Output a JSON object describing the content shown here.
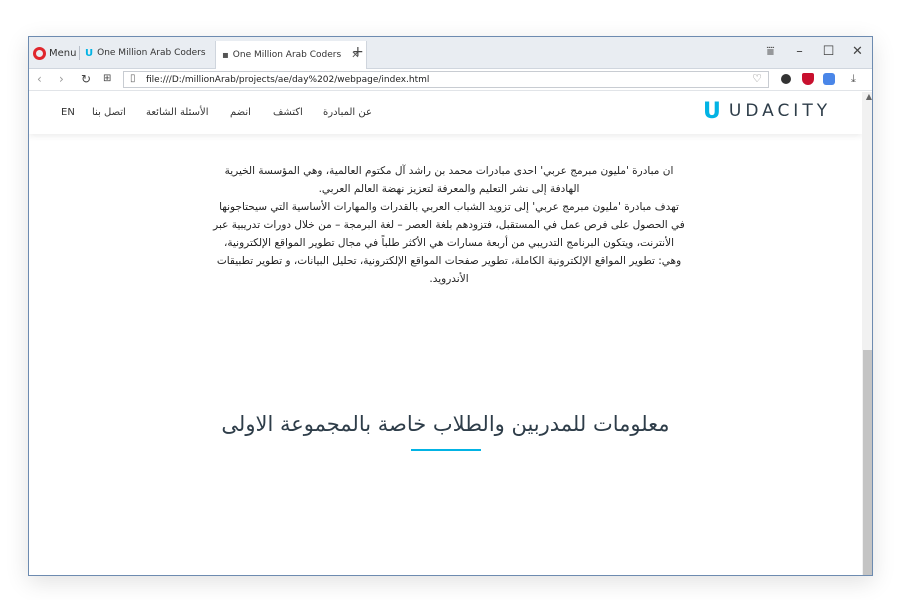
{
  "browser": {
    "menu_label": "Menu",
    "tabs": [
      {
        "title": "One Million Arab Coders",
        "active": false
      },
      {
        "title": "One Million Arab Coders",
        "active": true
      }
    ],
    "new_tab": "+",
    "url": "file:///D:/millionArab/projects/ae/day%202/webpage/index.html",
    "controls": {
      "minimize": "–",
      "maximize": "☐",
      "close": "✕",
      "tabmenu": "⩸"
    }
  },
  "site": {
    "brand": "UDACITY",
    "brand_mark": "U",
    "nav": {
      "en": "EN",
      "contact": "اتصل بنا",
      "faq": "الأسئلة الشائعة",
      "join": "انضم",
      "discover": "اكتشف",
      "about": "عن المبادرة"
    },
    "about_lines": [
      "ان مبادرة 'مليون مبرمج عربي' احدى مبادرات محمد بن راشد آل مكتوم العالمية، وهي المؤسسة الخيرية",
      "الهادفة إلى نشر التعليم والمعرفة لتعزيز نهضة العالم العربي.",
      "تهدف مبادرة 'مليون مبرمج عربي' إلى تزويد الشباب العربي بالقدرات والمهارات الأساسية التي سيحتاجونها",
      "في الحصول على فرص عمل في المستقبل، فتزودهم بلغة العصر – لغة البرمجة – من خلال دورات تدريبية عبر",
      "الأنترنت، ويتكون البرنامج التدريبي من أربعة مسارات هي الأكثر طلباً في مجال تطوير المواقع الإلكترونية،",
      "وهي: تطوير المواقع الإلكترونية الكاملة، تطوير صفحات المواقع الإلكترونية، تحليل البيانات، و تطوير تطبيقات",
      "الأندرويد."
    ],
    "section_title": "معلومات للمدربين والطلاب خاصة بالمجموعة الاولى"
  },
  "colors": {
    "accent": "#02b3e4",
    "opera_red": "#e0262d"
  }
}
